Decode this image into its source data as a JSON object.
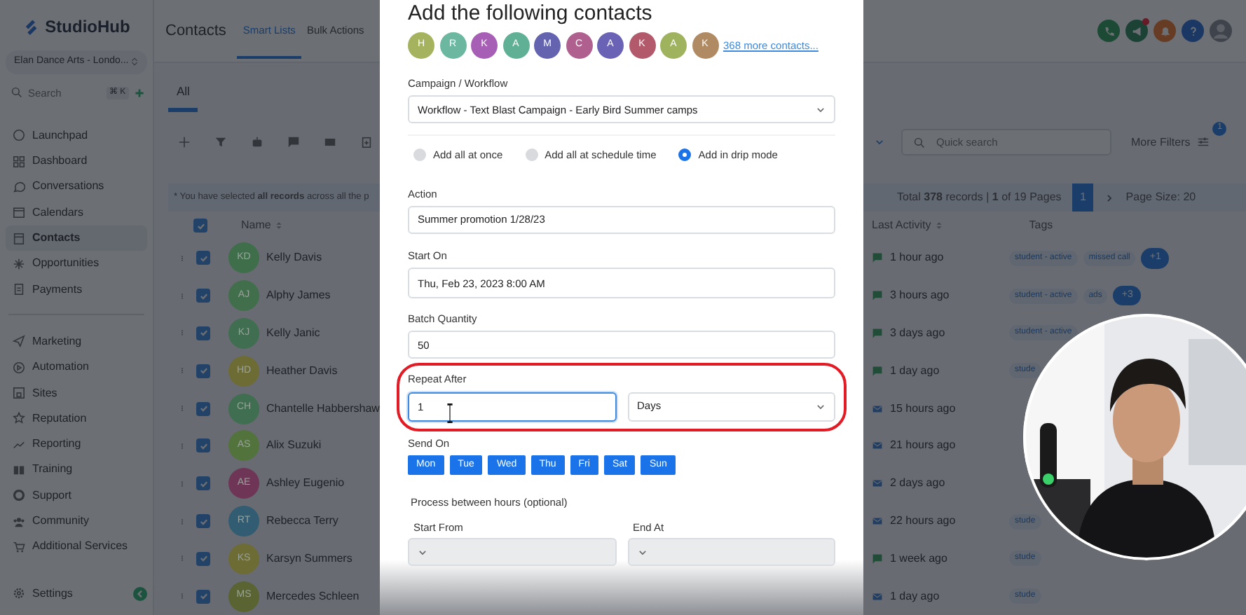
{
  "sidebar": {
    "logo": "StudioHub",
    "account": "Elan Dance Arts - Londo...",
    "search": {
      "placeholder": "Search",
      "shortcut": "⌘ K"
    },
    "sections": [
      {
        "items": [
          {
            "label": "Launchpad",
            "selected": false
          },
          {
            "label": "Dashboard",
            "selected": false
          },
          {
            "label": "Conversations",
            "selected": false
          },
          {
            "label": "Calendars",
            "selected": false
          },
          {
            "label": "Contacts",
            "selected": true
          },
          {
            "label": "Opportunities",
            "selected": false
          },
          {
            "label": "Payments",
            "selected": false
          }
        ]
      },
      {
        "items": [
          {
            "label": "Marketing",
            "selected": false
          },
          {
            "label": "Automation",
            "selected": false
          },
          {
            "label": "Sites",
            "selected": false
          },
          {
            "label": "Reputation",
            "selected": false
          },
          {
            "label": "Reporting",
            "selected": false
          },
          {
            "label": "Training",
            "selected": false
          },
          {
            "label": "Support",
            "selected": false
          },
          {
            "label": "Community",
            "selected": false
          },
          {
            "label": "Additional Services",
            "selected": false
          }
        ]
      }
    ],
    "footer_item": {
      "label": "Settings",
      "selected": false
    }
  },
  "header": {
    "title": "Contacts",
    "tabs": [
      {
        "label": "Smart Lists",
        "selected": true
      },
      {
        "label": "Bulk Actions",
        "selected": false
      }
    ],
    "announcement_unread": true
  },
  "subtabs": [
    {
      "label": "All",
      "selected": true
    }
  ],
  "toolbar": {
    "search": {
      "placeholder": "Quick search"
    },
    "filters": {
      "label": "More Filters",
      "badge": "1"
    }
  },
  "selection_banner": "* You have selected **all records** across all the p",
  "pagination": {
    "summary": "Total **378** records | **1** of 19 Pages",
    "pages": [
      {
        "label": "1",
        "selected": true
      }
    ],
    "page_size": "Page Size: 20"
  },
  "table": {
    "columns": [
      "Name",
      "Last Activity",
      "Tags"
    ],
    "all_checked": true,
    "rows": [
      {
        "initials": "KD",
        "color": "#3f6e4a",
        "name": "Kelly Davis",
        "checked": true,
        "activity": "1 hour ago",
        "kind": "chat",
        "tags": [
          "student - active",
          "missed call"
        ],
        "more_tags": "+1"
      },
      {
        "initials": "AJ",
        "color": "#426f4b",
        "name": "Alphy James",
        "checked": true,
        "activity": "3 hours ago",
        "kind": "chat",
        "tags": [
          "student - active",
          "ads"
        ],
        "more_tags": "+3"
      },
      {
        "initials": "KJ",
        "color": "#3f6e50",
        "name": "Kelly Janic",
        "checked": true,
        "activity": "3 days ago",
        "kind": "chat",
        "tags": [
          "student - active"
        ]
      },
      {
        "initials": "HD",
        "color": "#6e6c35",
        "name": "Heather Davis",
        "checked": true,
        "activity": "1 day ago",
        "kind": "chat",
        "tags": [
          "stude"
        ]
      },
      {
        "initials": "CH",
        "color": "#3f6e50",
        "name": "Chantelle Habbershaw",
        "checked": true,
        "activity": "15 hours ago",
        "kind": "mail",
        "tags": []
      },
      {
        "initials": "AS",
        "color": "#52733c",
        "name": "Alix Suzuki",
        "checked": true,
        "activity": "21 hours ago",
        "kind": "mail",
        "tags": []
      },
      {
        "initials": "AE",
        "color": "#6e3557",
        "name": "Ashley Eugenio",
        "checked": true,
        "activity": "2 days ago",
        "kind": "mail",
        "tags": []
      },
      {
        "initials": "RT",
        "color": "#325c72",
        "name": "Rebecca Terry",
        "checked": true,
        "activity": "22 hours ago",
        "kind": "mail",
        "tags": [
          "stude"
        ]
      },
      {
        "initials": "KS",
        "color": "#6e6c35",
        "name": "Karsyn Summers",
        "checked": true,
        "activity": "1 week ago",
        "kind": "chat",
        "tags": [
          "stude"
        ]
      },
      {
        "initials": "MS",
        "color": "#5a6433",
        "name": "Mercedes Schleen",
        "checked": true,
        "activity": "1 day ago",
        "kind": "mail",
        "tags": [
          "stude"
        ]
      }
    ]
  },
  "modal": {
    "title": "Add the following contacts",
    "contacts": [
      {
        "initial": "H",
        "color": "#a6b35e"
      },
      {
        "initial": "R",
        "color": "#6cb7a0"
      },
      {
        "initial": "K",
        "color": "#a65fb5"
      },
      {
        "initial": "A",
        "color": "#5fb095"
      },
      {
        "initial": "M",
        "color": "#6363b0"
      },
      {
        "initial": "C",
        "color": "#b0608e"
      },
      {
        "initial": "A",
        "color": "#6a62b5"
      },
      {
        "initial": "K",
        "color": "#b25a6c"
      },
      {
        "initial": "A",
        "color": "#9fb25e"
      },
      {
        "initial": "K",
        "color": "#b08a62"
      }
    ],
    "more_link": "368 more contacts...",
    "campaign": {
      "label": "Campaign / Workflow",
      "value": "Workflow - Text Blast Campaign - Early Bird Summer camps"
    },
    "modes": [
      {
        "label": "Add all at once",
        "selected": false
      },
      {
        "label": "Add all at schedule time",
        "selected": false
      },
      {
        "label": "Add in drip mode",
        "selected": true
      }
    ],
    "action": {
      "label": "Action",
      "value": "Summer promotion 1/28/23"
    },
    "start_on": {
      "label": "Start On",
      "value": "Thu, Feb 23, 2023 8:00 AM"
    },
    "batch_quantity": {
      "label": "Batch Quantity",
      "value": "50"
    },
    "repeat_after": {
      "label": "Repeat After",
      "value": "1",
      "focused": true,
      "unit": "Days",
      "highlighted": true
    },
    "send_on": {
      "label": "Send On",
      "days": [
        {
          "label": "Mon",
          "selected": true
        },
        {
          "label": "Tue",
          "selected": true
        },
        {
          "label": "Wed",
          "selected": true
        },
        {
          "label": "Thu",
          "selected": true
        },
        {
          "label": "Fri",
          "selected": true
        },
        {
          "label": "Sat",
          "selected": true
        },
        {
          "label": "Sun",
          "selected": true
        }
      ]
    },
    "hours": {
      "title": "Process between hours (optional)",
      "start_label": "Start From",
      "end_label": "End At"
    }
  }
}
